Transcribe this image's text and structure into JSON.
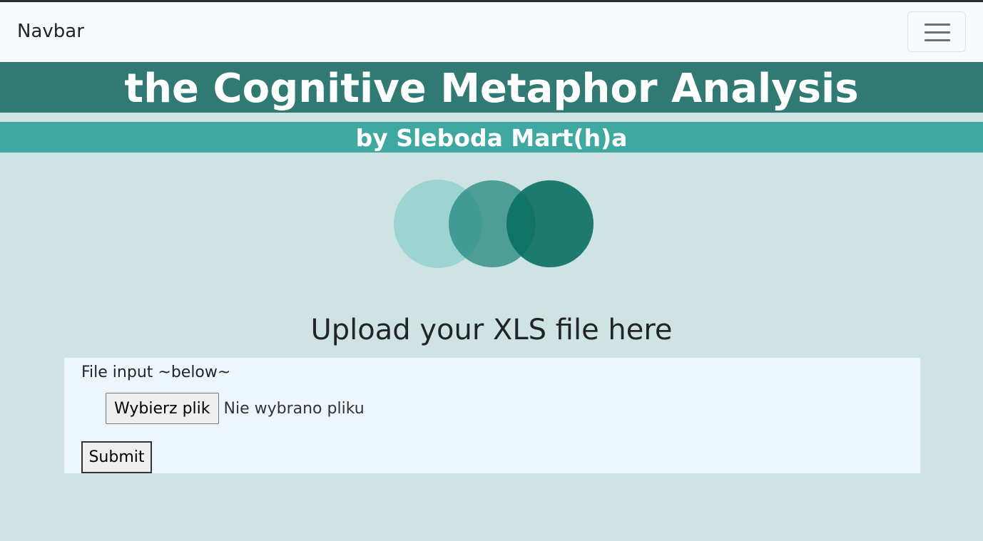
{
  "navbar": {
    "brand": "Navbar",
    "toggler_icon": "hamburger-icon"
  },
  "header": {
    "title": "the Cognitive Metaphor Analysis",
    "subtitle": "by Sleboda Mart(h)a"
  },
  "logo": {
    "circle_colors": [
      "#7fcdc7",
      "#2a8c84",
      "#0a6e62"
    ]
  },
  "upload": {
    "heading": "Upload your XLS file here",
    "file_label": "File input ~below~",
    "choose_button": "Wybierz plik",
    "file_status": "Nie wybrano pliku",
    "submit_label": "Submit"
  },
  "colors": {
    "page_background": "#cfe3e2",
    "title_band": "#317a73",
    "subtitle_band": "#3fa8a1",
    "form_panel": "#eef6fd"
  }
}
